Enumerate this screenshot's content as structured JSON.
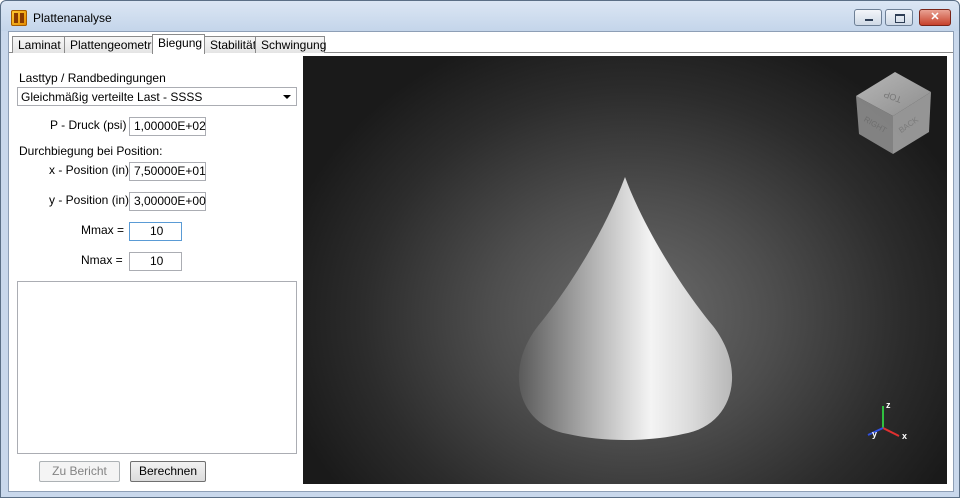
{
  "window": {
    "title": "Plattenanalyse"
  },
  "tabs": [
    "Laminat",
    "Plattengeometrie",
    "Biegung",
    "Stabilität",
    "Schwingung"
  ],
  "active_tab": "Biegung",
  "form": {
    "load_type_label": "Lasttyp / Randbedingungen",
    "load_type_value": "Gleichmäßig verteilte Last - SSSS",
    "pressure_label": "P - Druck (psi)",
    "pressure_value": "1,00000E+02",
    "deflection_label": "Durchbiegung bei Position:",
    "x_label": "x - Position (in)",
    "x_value": "7,50000E+01",
    "y_label": "y - Position (in)",
    "y_value": "3,00000E+00",
    "mmax_label": "Mmax =",
    "mmax_value": "10",
    "nmax_label": "Nmax =",
    "nmax_value": "10"
  },
  "buttons": {
    "report": "Zu Bericht",
    "compute": "Berechnen"
  },
  "viewcube": {
    "top": "TOP",
    "right": "RIGHT",
    "back": "BACK"
  },
  "axes": {
    "z": "z",
    "y": "y",
    "x": "x"
  },
  "colors": {
    "axis_x": "#e03030",
    "axis_y": "#3050e0",
    "axis_z": "#30c040"
  }
}
